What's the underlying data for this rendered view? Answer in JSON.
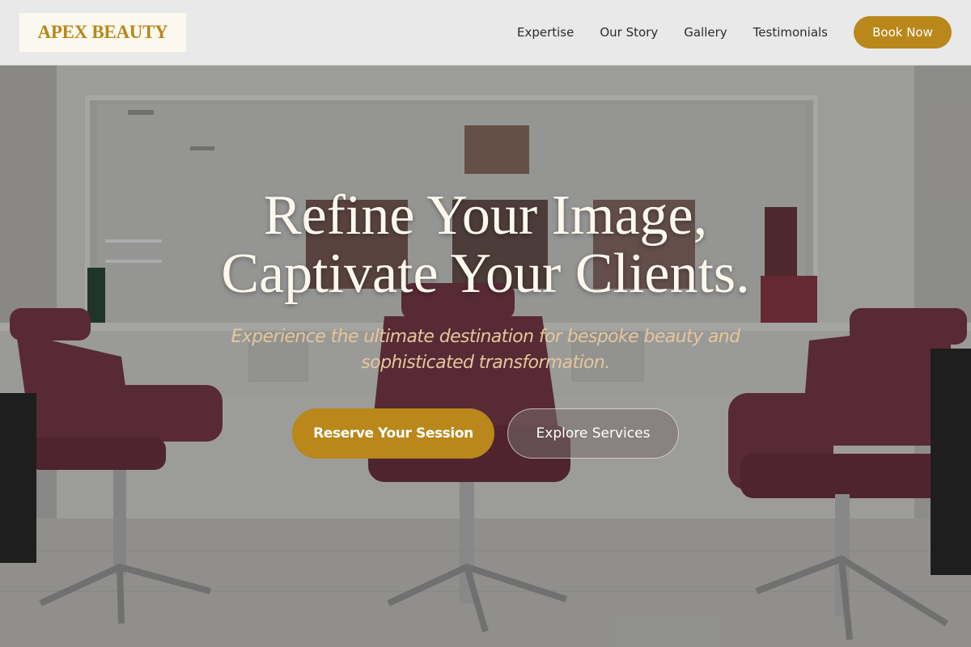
{
  "header": {
    "logo_text": "APEX BEAUTY",
    "nav": [
      {
        "label": "Expertise"
      },
      {
        "label": "Our Story"
      },
      {
        "label": "Gallery"
      },
      {
        "label": "Testimonials"
      }
    ],
    "cta_label": "Book Now"
  },
  "hero": {
    "title_line1": "Refine Your Image,",
    "title_line2": "Captivate Your Clients.",
    "subtitle": "Experience the ultimate destination for bespoke beauty and sophisticated transformation.",
    "primary_button": "Reserve Your Session",
    "secondary_button": "Explore Services",
    "background_image": "salon-interior"
  },
  "colors": {
    "accent": "#b9871a",
    "header_bg": "#e9e9e9",
    "logo_bg": "#fbf9ef",
    "title_text": "#fdf8ee",
    "subtitle_text": "#e5c79a",
    "chair": "#7a3b4a"
  }
}
